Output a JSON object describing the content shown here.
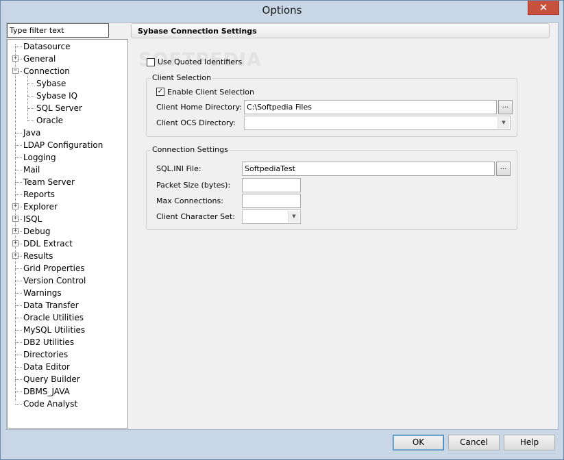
{
  "window": {
    "title": "Options",
    "close_label": "✕"
  },
  "filter": {
    "placeholder": "Type filter text",
    "value": "Type filter text"
  },
  "tree": {
    "items": [
      {
        "label": "Datasource",
        "level": 0,
        "expander": ""
      },
      {
        "label": "General",
        "level": 0,
        "expander": "+"
      },
      {
        "label": "Connection",
        "level": 0,
        "expander": "−"
      },
      {
        "label": "Sybase",
        "level": 1,
        "expander": ""
      },
      {
        "label": "Sybase IQ",
        "level": 1,
        "expander": ""
      },
      {
        "label": "SQL Server",
        "level": 1,
        "expander": ""
      },
      {
        "label": "Oracle",
        "level": 1,
        "expander": ""
      },
      {
        "label": "Java",
        "level": 0,
        "expander": ""
      },
      {
        "label": "LDAP Configuration",
        "level": 0,
        "expander": ""
      },
      {
        "label": "Logging",
        "level": 0,
        "expander": ""
      },
      {
        "label": "Mail",
        "level": 0,
        "expander": ""
      },
      {
        "label": "Team Server",
        "level": 0,
        "expander": ""
      },
      {
        "label": "Reports",
        "level": 0,
        "expander": ""
      },
      {
        "label": "Explorer",
        "level": 0,
        "expander": "+"
      },
      {
        "label": "ISQL",
        "level": 0,
        "expander": "+"
      },
      {
        "label": "Debug",
        "level": 0,
        "expander": "+"
      },
      {
        "label": "DDL Extract",
        "level": 0,
        "expander": "+"
      },
      {
        "label": "Results",
        "level": 0,
        "expander": "+"
      },
      {
        "label": "Grid Properties",
        "level": 0,
        "expander": ""
      },
      {
        "label": "Version Control",
        "level": 0,
        "expander": ""
      },
      {
        "label": "Warnings",
        "level": 0,
        "expander": ""
      },
      {
        "label": "Data Transfer",
        "level": 0,
        "expander": ""
      },
      {
        "label": "Oracle Utilities",
        "level": 0,
        "expander": ""
      },
      {
        "label": "MySQL Utilities",
        "level": 0,
        "expander": ""
      },
      {
        "label": "DB2 Utilities",
        "level": 0,
        "expander": ""
      },
      {
        "label": "Directories",
        "level": 0,
        "expander": ""
      },
      {
        "label": "Data Editor",
        "level": 0,
        "expander": ""
      },
      {
        "label": "Query Builder",
        "level": 0,
        "expander": ""
      },
      {
        "label": "DBMS_JAVA",
        "level": 0,
        "expander": ""
      },
      {
        "label": "Code Analyst",
        "level": 0,
        "expander": ""
      }
    ]
  },
  "panel": {
    "header": "Sybase Connection Settings",
    "watermark": "SOFTPEDIA",
    "use_quoted_identifiers": {
      "label": "Use Quoted Identifiers",
      "checked": false,
      "mark": ""
    },
    "client_selection": {
      "title": "Client Selection",
      "enable": {
        "label": "Enable Client Selection",
        "checked": true,
        "mark": "✓"
      },
      "home_dir_label": "Client Home Directory:",
      "home_dir_value": "C:\\Softpedia Files",
      "ocs_dir_label": "Client OCS Directory:",
      "ocs_dir_value": "",
      "browse_label": "..."
    },
    "connection_settings": {
      "title": "Connection Settings",
      "sql_ini_label": "SQL.INI File:",
      "sql_ini_value": "SoftpediaTest",
      "packet_size_label": "Packet Size (bytes):",
      "packet_size_value": "",
      "max_conn_label": "Max Connections:",
      "max_conn_value": "",
      "charset_label": "Client Character Set:",
      "charset_value": "",
      "browse_label": "..."
    },
    "dropdown_arrow": "▼"
  },
  "footer": {
    "ok": "OK",
    "cancel": "Cancel",
    "help": "Help"
  }
}
